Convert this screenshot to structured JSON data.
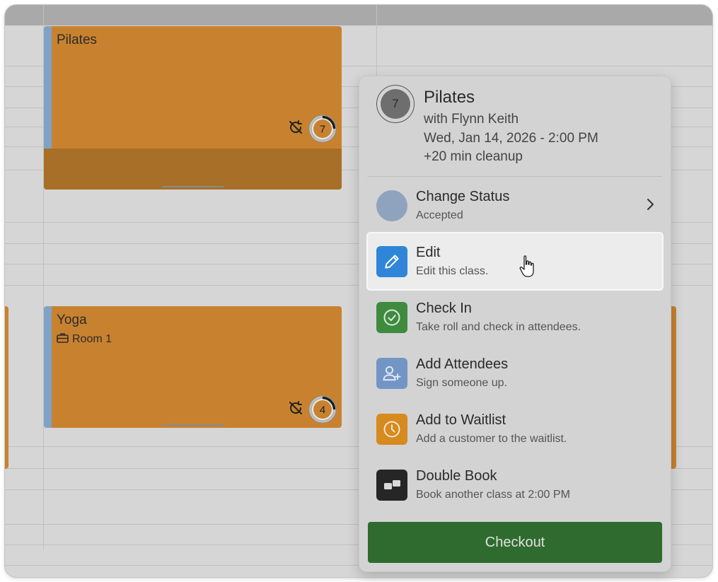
{
  "events": [
    {
      "title": "Pilates",
      "badge_count": "7"
    },
    {
      "title": "Yoga",
      "room": "Room 1",
      "badge_count": "4"
    }
  ],
  "popup": {
    "badge_count": "7",
    "title": "Pilates",
    "instructor": "with Flynn Keith",
    "datetime": "Wed, Jan 14, 2026 - 2:00 PM",
    "cleanup": "+20 min cleanup",
    "menu": {
      "change_status": {
        "label": "Change Status",
        "sub": "Accepted"
      },
      "edit": {
        "label": "Edit",
        "sub": "Edit this class."
      },
      "check_in": {
        "label": "Check In",
        "sub": "Take roll and check in attendees."
      },
      "add_attendees": {
        "label": "Add Attendees",
        "sub": "Sign someone up."
      },
      "add_waitlist": {
        "label": "Add to Waitlist",
        "sub": "Add a customer to the waitlist."
      },
      "double_book": {
        "label": "Double Book",
        "sub": "Book another class at 2:00 PM"
      }
    },
    "checkout_label": "Checkout"
  },
  "colors": {
    "event_orange": "#c8822f",
    "event_stripe": "#7fa3c4",
    "status_circle": "#8fa3bf",
    "edit_blue": "#2f86d8",
    "checkin_green": "#3e8b3e",
    "attendees_blue": "#7395c6",
    "waitlist_orange": "#d68a1f",
    "doublebook_black": "#262626",
    "checkout_green": "#2f6b2f"
  },
  "icons": [
    "no-repeat-icon",
    "capacity-ring-icon",
    "briefcase-icon",
    "chevron-right-icon",
    "pencil-icon",
    "check-circle-icon",
    "add-user-icon",
    "clock-icon",
    "double-book-icon",
    "hand-cursor-icon"
  ]
}
